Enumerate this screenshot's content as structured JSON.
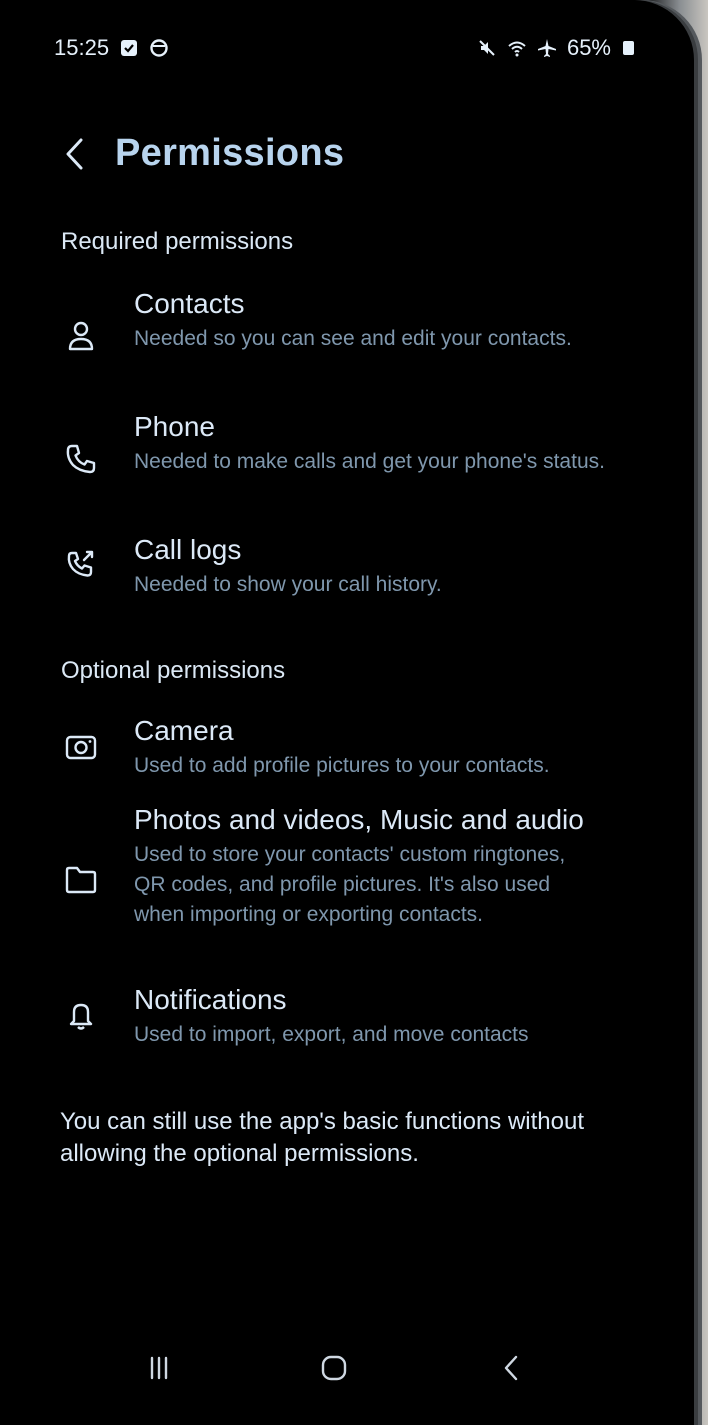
{
  "status_bar": {
    "time": "15:25",
    "battery": "65%",
    "left_icons": [
      "checkbox-icon",
      "circle-status-icon"
    ],
    "right_icons": [
      "mute-icon",
      "wifi-icon",
      "airplane-icon",
      "battery-icon"
    ]
  },
  "header": {
    "title": "Permissions",
    "back_icon": "chevron-left-icon"
  },
  "required": {
    "label": "Required permissions",
    "items": [
      {
        "title": "Contacts",
        "description": "Needed so you can see and edit your contacts.",
        "icon": "person-icon"
      },
      {
        "title": "Phone",
        "description": "Needed to make calls and get your phone's status.",
        "icon": "phone-icon"
      },
      {
        "title": "Call logs",
        "description": "Needed to show your call history.",
        "icon": "call-log-icon"
      }
    ]
  },
  "optional": {
    "label": "Optional permissions",
    "items": [
      {
        "title": "Camera",
        "description": "Used to add profile pictures to your contacts.",
        "icon": "camera-icon"
      },
      {
        "title": "Photos and videos, Music and audio",
        "description": "Used to store your contacts' custom ringtones, QR codes, and profile pictures. It's also used when importing or exporting contacts.",
        "icon": "folder-icon"
      },
      {
        "title": "Notifications",
        "description": "Used to import, export, and move contacts",
        "icon": "bell-icon"
      }
    ]
  },
  "footer_note": "You can still use the app's basic functions without allowing the optional permissions.",
  "nav_bar": {
    "icons": [
      "recent-apps-icon",
      "home-icon",
      "back-icon"
    ]
  },
  "colors": {
    "background": "#000000",
    "title": "#b8d4ee",
    "item_title": "#dce9f7",
    "item_description": "#7f97ad"
  }
}
